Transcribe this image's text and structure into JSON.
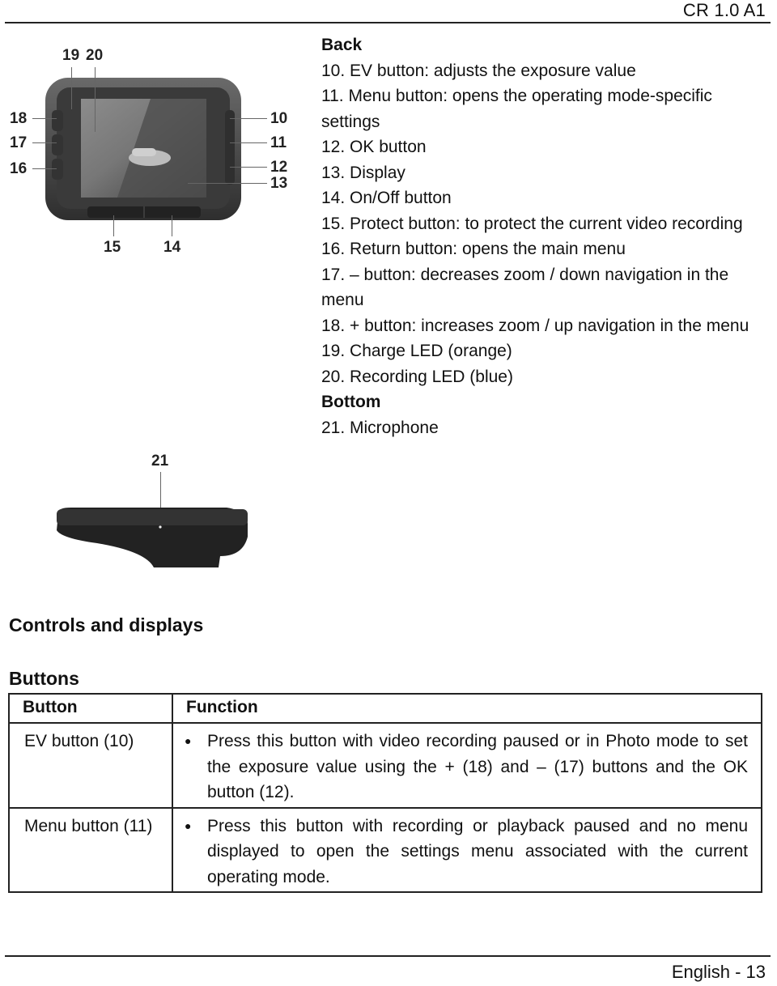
{
  "header": {
    "doc_code": "CR 1.0 A1"
  },
  "footer": {
    "page_label": "English - 13"
  },
  "figure_back": {
    "callouts": [
      "18",
      "17",
      "16",
      "19",
      "20",
      "10",
      "11",
      "12",
      "13",
      "15",
      "14"
    ]
  },
  "figure_bottom": {
    "callouts": [
      "21"
    ]
  },
  "description": {
    "back_heading": "Back",
    "back_items": [
      "10. EV button: adjusts the exposure value",
      "11. Menu button: opens the operating mode-specific settings",
      "12. OK button",
      "13. Display",
      "14. On/Off button",
      "15. Protect button: to protect the current video recording",
      "16. Return button: opens the main menu",
      "17. – button: decreases zoom / down navigation in the menu",
      "18. + button: increases zoom / up navigation in the menu",
      "19. Charge LED (orange)",
      "20. Recording LED (blue)"
    ],
    "bottom_heading": "Bottom",
    "bottom_items": [
      "21. Microphone"
    ]
  },
  "section": {
    "title": "Controls and displays",
    "subtitle": "Buttons"
  },
  "table": {
    "headers": [
      "Button",
      "Function"
    ],
    "rows": [
      {
        "button": "EV button (10)",
        "function": "Press this button with video recording paused or in Photo mode to set the exposure value using the + (18) and – (17) buttons and the OK button (12)."
      },
      {
        "button": "Menu button (11)",
        "function": "Press this button with recording or playback paused and no menu displayed to open the settings menu associated with the current operating mode."
      }
    ]
  }
}
